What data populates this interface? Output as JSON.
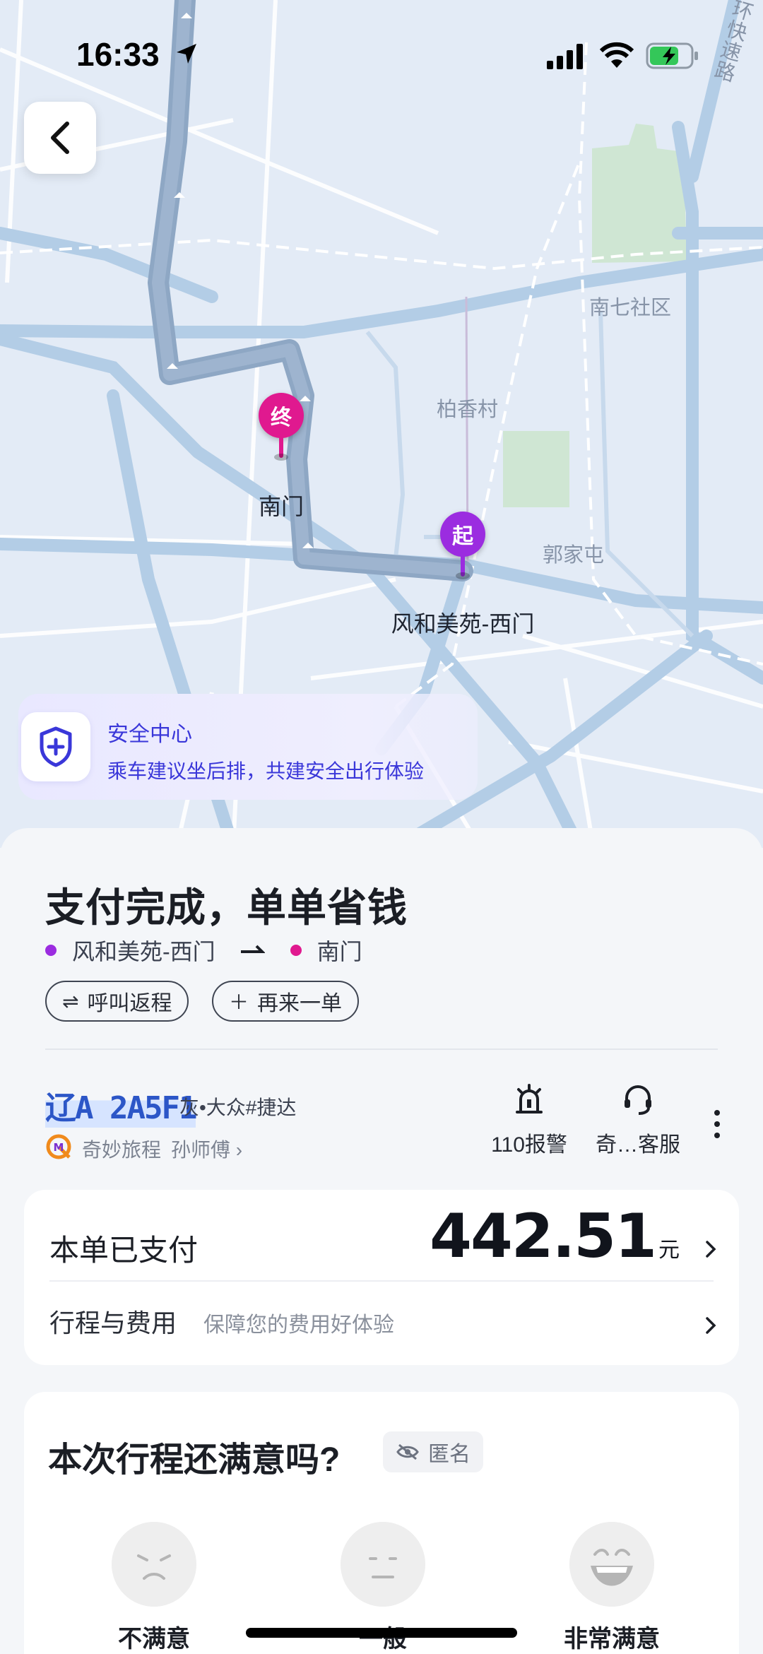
{
  "status_bar": {
    "time": "16:33"
  },
  "map": {
    "areas": {
      "nanqi": "南七社区",
      "baixiang": "柏香村",
      "guojia": "郭家屯"
    },
    "road_label": "环快速路",
    "end_pin": "终",
    "start_pin": "起",
    "end_name": "南门",
    "start_name": "风和美苑-西门"
  },
  "safety": {
    "title": "安全中心",
    "subtitle": "乘车建议坐后排，共建安全出行体验"
  },
  "trip": {
    "headline": "支付完成，单单省钱",
    "from": "风和美苑-西门",
    "to": "南门",
    "call_return": "呼叫返程",
    "order_again": "再来一单"
  },
  "driver": {
    "plate": "辽A 2A5F1",
    "car": "灰•大众#捷达",
    "company": "奇妙旅程",
    "name": "孙师傅"
  },
  "actions": {
    "alarm": "110报警",
    "service": "奇…客服"
  },
  "payment": {
    "paid_label": "本单已支付",
    "amount": "442.51",
    "unit": "元",
    "fee_label": "行程与费用",
    "fee_sub": "保障您的费用好体验"
  },
  "rating": {
    "title": "本次行程还满意吗?",
    "anonymous": "匿名",
    "options": [
      "不满意",
      "一般",
      "非常满意"
    ]
  },
  "colors": {
    "route": "#8ea7c4",
    "start_pin": "#9b2ce0",
    "end_pin": "#e0198f",
    "accent": "#3a37d9"
  }
}
